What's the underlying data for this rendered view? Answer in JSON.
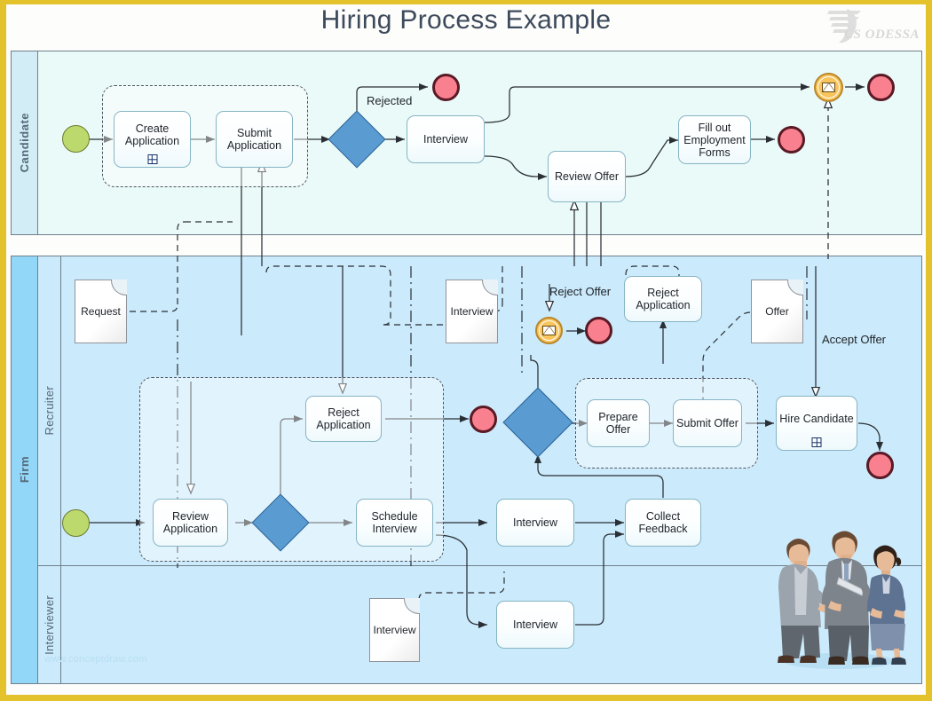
{
  "document": {
    "title": "Hiring Process Example",
    "logo_text": "CS ODESSA",
    "watermark": "www.conceptdraw.com"
  },
  "colors": {
    "frame": "#e3c22c",
    "title": "#3d4a5c",
    "pool_candidate_bg": "#eafaf8",
    "pool_candidate_band": "#d2edf6",
    "pool_firm_bg": "#cbeafb",
    "pool_firm_band": "#92d7f7",
    "task_border": "#86b5c4",
    "gateway_fill": "#5a9bd1",
    "start_event": "#bcd96e",
    "end_event": "#f9808f",
    "message_event": "#f7c55c",
    "lane_border": "#6f7f8c"
  },
  "pools": [
    {
      "id": "candidate",
      "label": "Candidate",
      "lanes": []
    },
    {
      "id": "firm",
      "label": "Firm",
      "lanes": [
        {
          "id": "recruiter",
          "label": "Recruiter"
        },
        {
          "id": "interviewer",
          "label": "Interviewer"
        }
      ]
    }
  ],
  "elements": {
    "candidate": {
      "start_event": {
        "type": "start-event",
        "label": ""
      },
      "tasks": [
        {
          "id": "create-application",
          "label": "Create Application",
          "marker": "sub-process"
        },
        {
          "id": "submit-application",
          "label": "Submit Application",
          "marker": "none"
        },
        {
          "id": "interview",
          "label": "Interview",
          "marker": "none"
        },
        {
          "id": "review-offer",
          "label": "Review Offer",
          "marker": "none"
        },
        {
          "id": "fill-out-employment-forms",
          "label": "Fill out Employment Forms",
          "marker": "none"
        }
      ],
      "gateway": {
        "id": "candidate-gateway",
        "type": "exclusive-gateway"
      },
      "events": [
        {
          "id": "rejected-end",
          "type": "end-event"
        },
        {
          "id": "forms-end",
          "type": "end-event"
        },
        {
          "id": "message-intermediate",
          "type": "message-event"
        },
        {
          "id": "final-end",
          "type": "end-event"
        }
      ],
      "flow_labels": [
        "Rejected"
      ]
    },
    "recruiter": {
      "start_event": {
        "type": "start-event",
        "label": ""
      },
      "tasks": [
        {
          "id": "review-application",
          "label": "Review Application",
          "marker": "none"
        },
        {
          "id": "reject-application-1",
          "label": "Reject Application",
          "marker": "none"
        },
        {
          "id": "schedule-interview",
          "label": "Schedule Interview",
          "marker": "none"
        },
        {
          "id": "interview-recruiter",
          "label": "Interview",
          "marker": "none"
        },
        {
          "id": "collect-feedback",
          "label": "Collect Feedback",
          "marker": "none"
        },
        {
          "id": "prepare-offer",
          "label": "Prepare Offer",
          "marker": "none"
        },
        {
          "id": "submit-offer",
          "label": "Submit Offer",
          "marker": "none"
        },
        {
          "id": "reject-application-2",
          "label": "Reject Application",
          "marker": "none"
        },
        {
          "id": "hire-candidate",
          "label": "Hire Candidate",
          "marker": "sub-process"
        }
      ],
      "gateways": [
        {
          "id": "review-gateway",
          "type": "exclusive-gateway"
        },
        {
          "id": "offer-gateway",
          "type": "exclusive-gateway"
        }
      ],
      "events": [
        {
          "id": "reject-app-end",
          "type": "end-event"
        },
        {
          "id": "reject-offer-msg",
          "type": "message-event"
        },
        {
          "id": "reject-offer-end",
          "type": "end-event"
        },
        {
          "id": "hire-end",
          "type": "end-event"
        }
      ],
      "data_objects": [
        {
          "id": "request-doc",
          "label": "Request"
        },
        {
          "id": "interview-doc-recruiter",
          "label": "Interview"
        },
        {
          "id": "offer-doc",
          "label": "Offer"
        }
      ],
      "flow_labels": [
        "Reject Offer",
        "Accept Offer"
      ]
    },
    "interviewer": {
      "tasks": [
        {
          "id": "interview-interviewer",
          "label": "Interview",
          "marker": "none"
        }
      ],
      "data_objects": [
        {
          "id": "interview-doc",
          "label": "Interview"
        }
      ]
    }
  }
}
